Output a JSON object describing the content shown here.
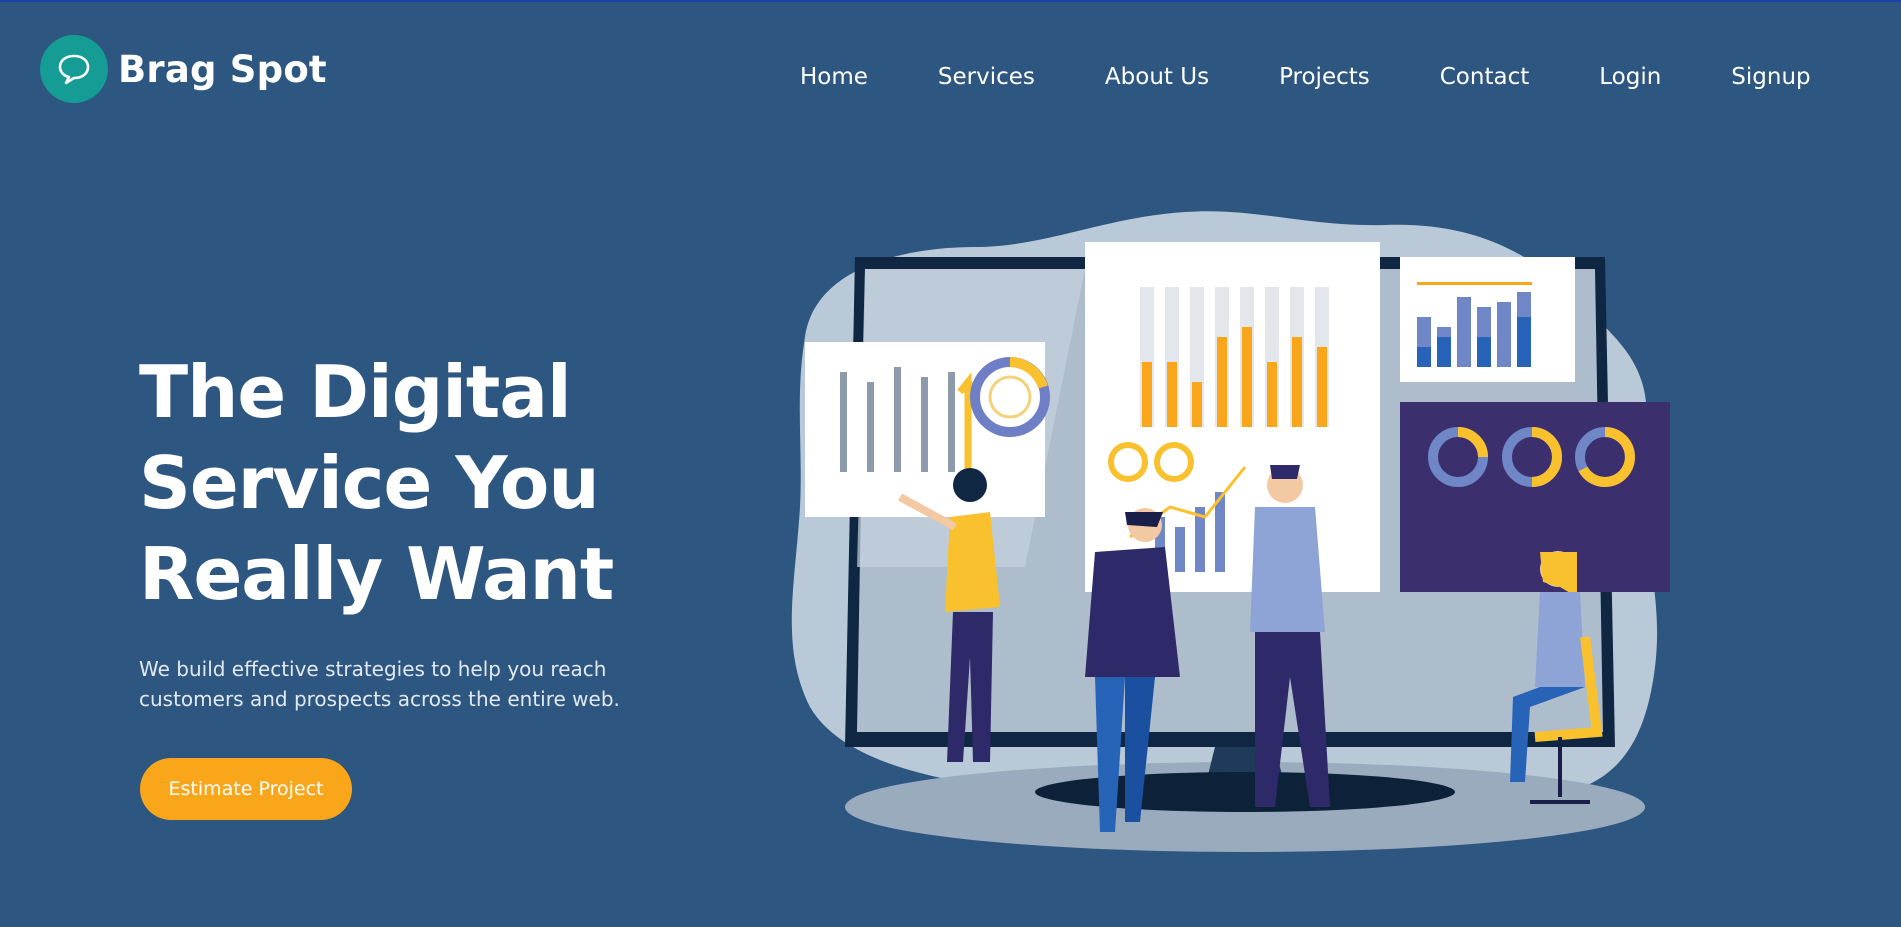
{
  "brand": {
    "name": "Brag Spot",
    "icon": "chat-bubble-icon",
    "icon_color": "#149c95"
  },
  "nav": {
    "items": [
      {
        "label": "Home"
      },
      {
        "label": "Services"
      },
      {
        "label": "About Us"
      },
      {
        "label": "Projects"
      },
      {
        "label": "Contact"
      },
      {
        "label": "Login"
      },
      {
        "label": "Signup"
      }
    ]
  },
  "hero": {
    "title_lines": [
      "The Digital",
      "Service You",
      "Really Want"
    ],
    "subtitle": "We build effective strategies to help you reach customers and prospects across the entire web.",
    "cta_label": "Estimate Project"
  },
  "colors": {
    "background": "#2d5680",
    "accent": "#f9a61a",
    "logo": "#149c95"
  },
  "illustration": {
    "icon": "business-analytics-illustration"
  }
}
